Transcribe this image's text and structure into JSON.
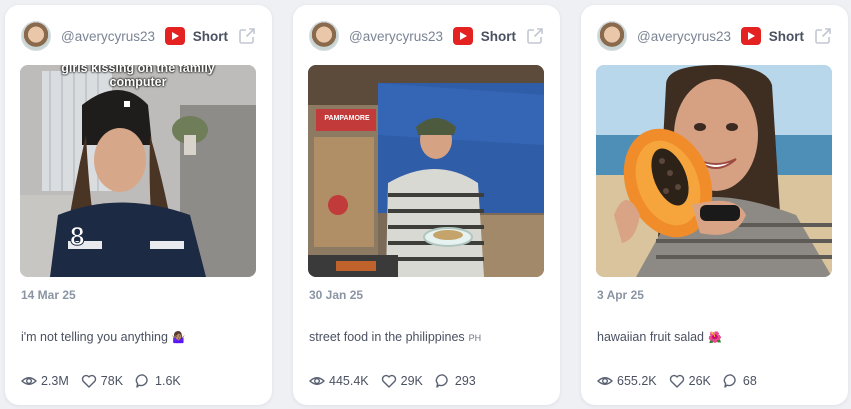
{
  "posts": [
    {
      "handle": "@averycyrus23",
      "platform_label": "Short",
      "overlay_text": "girls kissing on the family computer",
      "date": "14 Mar 25",
      "caption": "i'm not telling you anything",
      "caption_emoji": "🤷🏽‍♀️",
      "views": "2.3M",
      "likes": "78K",
      "comments": "1.6K"
    },
    {
      "handle": "@averycyrus23",
      "platform_label": "Short",
      "sign_text": "PAMPAMORE",
      "date": "30 Jan 25",
      "caption": "street food in the philippines",
      "caption_emoji": "PH",
      "views": "445.4K",
      "likes": "29K",
      "comments": "293"
    },
    {
      "handle": "@averycyrus23",
      "platform_label": "Short",
      "date": "3 Apr 25",
      "caption": "hawaiian fruit salad",
      "caption_emoji": "🌺",
      "views": "655.2K",
      "likes": "26K",
      "comments": "68"
    }
  ],
  "colors": {
    "youtube_red": "#e52222",
    "text": "#4a5160",
    "muted": "#8b94a3",
    "bg": "#eef0f4"
  },
  "icons": {
    "platform": "youtube-icon",
    "open": "external-link-icon",
    "views": "eye-icon",
    "likes": "heart-icon",
    "comments": "comment-icon"
  }
}
